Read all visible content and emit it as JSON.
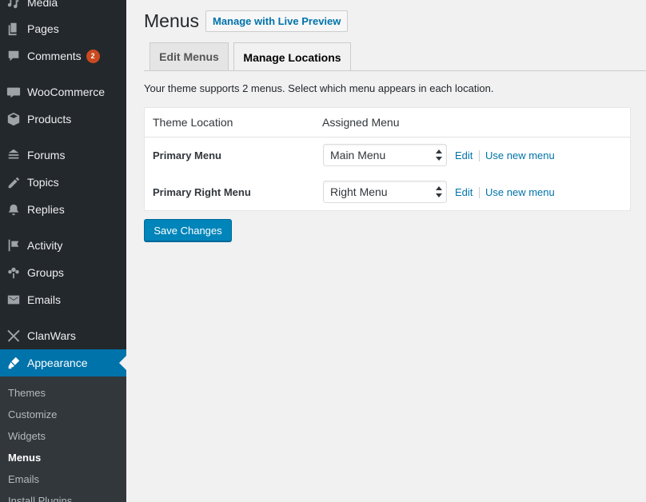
{
  "sidebar": {
    "items": [
      {
        "label": "Media",
        "icon": "media-icon"
      },
      {
        "label": "Pages",
        "icon": "pages-icon"
      },
      {
        "label": "Comments",
        "icon": "comments-icon",
        "badge": "2"
      },
      {
        "label": "WooCommerce",
        "icon": "woocommerce-icon"
      },
      {
        "label": "Products",
        "icon": "products-icon"
      },
      {
        "label": "Forums",
        "icon": "forums-icon"
      },
      {
        "label": "Topics",
        "icon": "topics-icon"
      },
      {
        "label": "Replies",
        "icon": "replies-icon"
      },
      {
        "label": "Activity",
        "icon": "activity-icon"
      },
      {
        "label": "Groups",
        "icon": "groups-icon"
      },
      {
        "label": "Emails",
        "icon": "emails-icon"
      },
      {
        "label": "ClanWars",
        "icon": "clanwars-icon"
      },
      {
        "label": "Appearance",
        "icon": "appearance-icon"
      }
    ],
    "submenu": [
      "Themes",
      "Customize",
      "Widgets",
      "Menus",
      "Emails",
      "Install Plugins"
    ],
    "active_submenu": "Menus"
  },
  "header": {
    "title": "Menus",
    "live_preview_label": "Manage with Live Preview"
  },
  "tabs": [
    {
      "label": "Edit Menus",
      "active": false
    },
    {
      "label": "Manage Locations",
      "active": true
    }
  ],
  "description": "Your theme supports 2 menus. Select which menu appears in each location.",
  "locations_table": {
    "headers": [
      "Theme Location",
      "Assigned Menu"
    ],
    "rows": [
      {
        "location": "Primary Menu",
        "assigned": "Main Menu",
        "edit_label": "Edit",
        "new_label": "Use new menu"
      },
      {
        "location": "Primary Right Menu",
        "assigned": "Right Menu",
        "edit_label": "Edit",
        "new_label": "Use new menu"
      }
    ]
  },
  "save_label": "Save Changes",
  "colors": {
    "sidebar_bg": "#23282d",
    "accent": "#0073aa",
    "primary_button": "#0085ba",
    "badge": "#ca4a1f"
  }
}
